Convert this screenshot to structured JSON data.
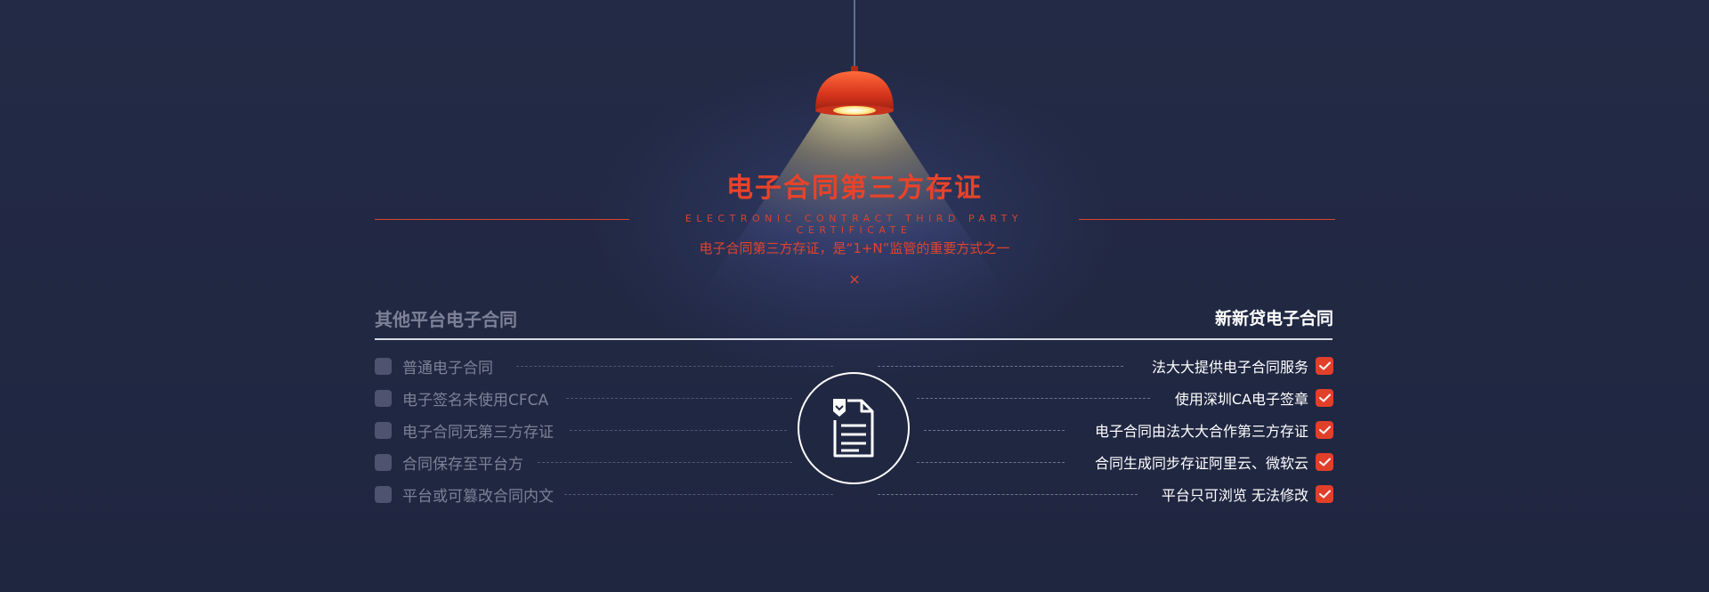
{
  "header": {
    "title": "电子合同第三方存证",
    "subtitle_en": "ELECTRONIC CONTRACT THIRD PARTY CERTIFICATE",
    "tagline": "电子合同第三方存证，是“1+N”监管的重要方式之一",
    "close_symbol": "×"
  },
  "comparison": {
    "left_title": "其他平台电子合同",
    "right_title": "新新贷电子合同",
    "left_items": [
      "普通电子合同",
      "电子签名未使用CFCA",
      "电子合同无第三方存证",
      "合同保存至平台方",
      "平台或可篡改合同内文"
    ],
    "right_items": [
      "法大大提供电子合同服务",
      "使用深圳CA电子签章",
      "电子合同由法大大合作第三方存证",
      "合同生成同步存证阿里云、微软云",
      "平台只可浏览 无法修改"
    ]
  },
  "icons": {
    "lamp": "pendant-lamp-icon",
    "center": "contract-document-icon",
    "check": "check-icon"
  },
  "colors": {
    "background": "#212842",
    "accent": "#e23f2a",
    "muted": "#7c8197",
    "text": "#ffffff"
  }
}
